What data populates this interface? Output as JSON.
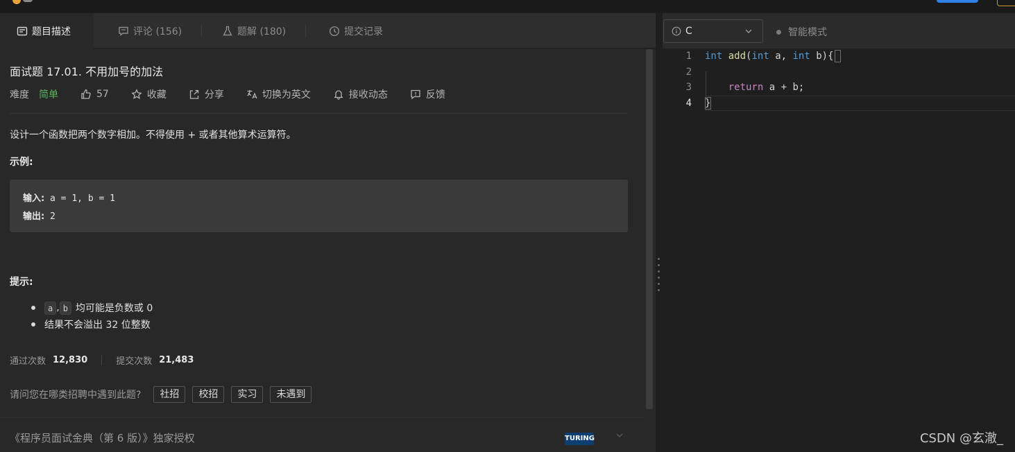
{
  "tabs": {
    "description": "题目描述",
    "comments": "评论 (156)",
    "solutions": "题解 (180)",
    "submissions": "提交记录"
  },
  "problem": {
    "title": "面试题 17.01. 不用加号的加法",
    "difficulty_label": "难度",
    "difficulty": "简单",
    "likes": "57",
    "favorite": "收藏",
    "share": "分享",
    "switch_lang": "切换为英文",
    "subscribe": "接收动态",
    "feedback": "反馈",
    "description": "设计一个函数把两个数字相加。不得使用 + 或者其他算术运算符。",
    "example_title": "示例:",
    "example_input_label": "输入:",
    "example_input": " a = 1, b = 1",
    "example_output_label": "输出:",
    "example_output": " 2",
    "hint_title": "提示:",
    "hints": {
      "h1_code_a": "a",
      "h1_comma": ",",
      "h1_code_b": "b",
      "h1_text": "均可能是负数或 0",
      "h2_text": "结果不会溢出 32 位整数"
    },
    "accepted_label": "通过次数",
    "accepted": "12,830",
    "submitted_label": "提交次数",
    "submitted": "21,483",
    "survey_question": "请问您在哪类招聘中遇到此题?",
    "survey_options": [
      "社招",
      "校招",
      "实习",
      "未遇到"
    ],
    "license": "《程序员面试金典（第 6 版）》独家授权",
    "publisher_logo_text": "TURING"
  },
  "editor": {
    "language": "C",
    "smart_mode": "智能模式",
    "line_numbers": [
      "1",
      "2",
      "3",
      "4"
    ],
    "code": {
      "l1_kw1": "int",
      "l1_fn": "add",
      "l1_p1": "(",
      "l1_kw2": "int",
      "l1_a": " a, ",
      "l1_kw3": "int",
      "l1_b": " b)",
      "l1_brace": "{",
      "l3_ret": "return",
      "l3_rest": " a + b;",
      "l4_brace": "}"
    }
  },
  "watermark": "CSDN @玄澈_",
  "colors": {
    "easy": "#5bb35e",
    "keyword": "#569cd6",
    "function": "#dcdcaa",
    "return": "#c586c0"
  }
}
